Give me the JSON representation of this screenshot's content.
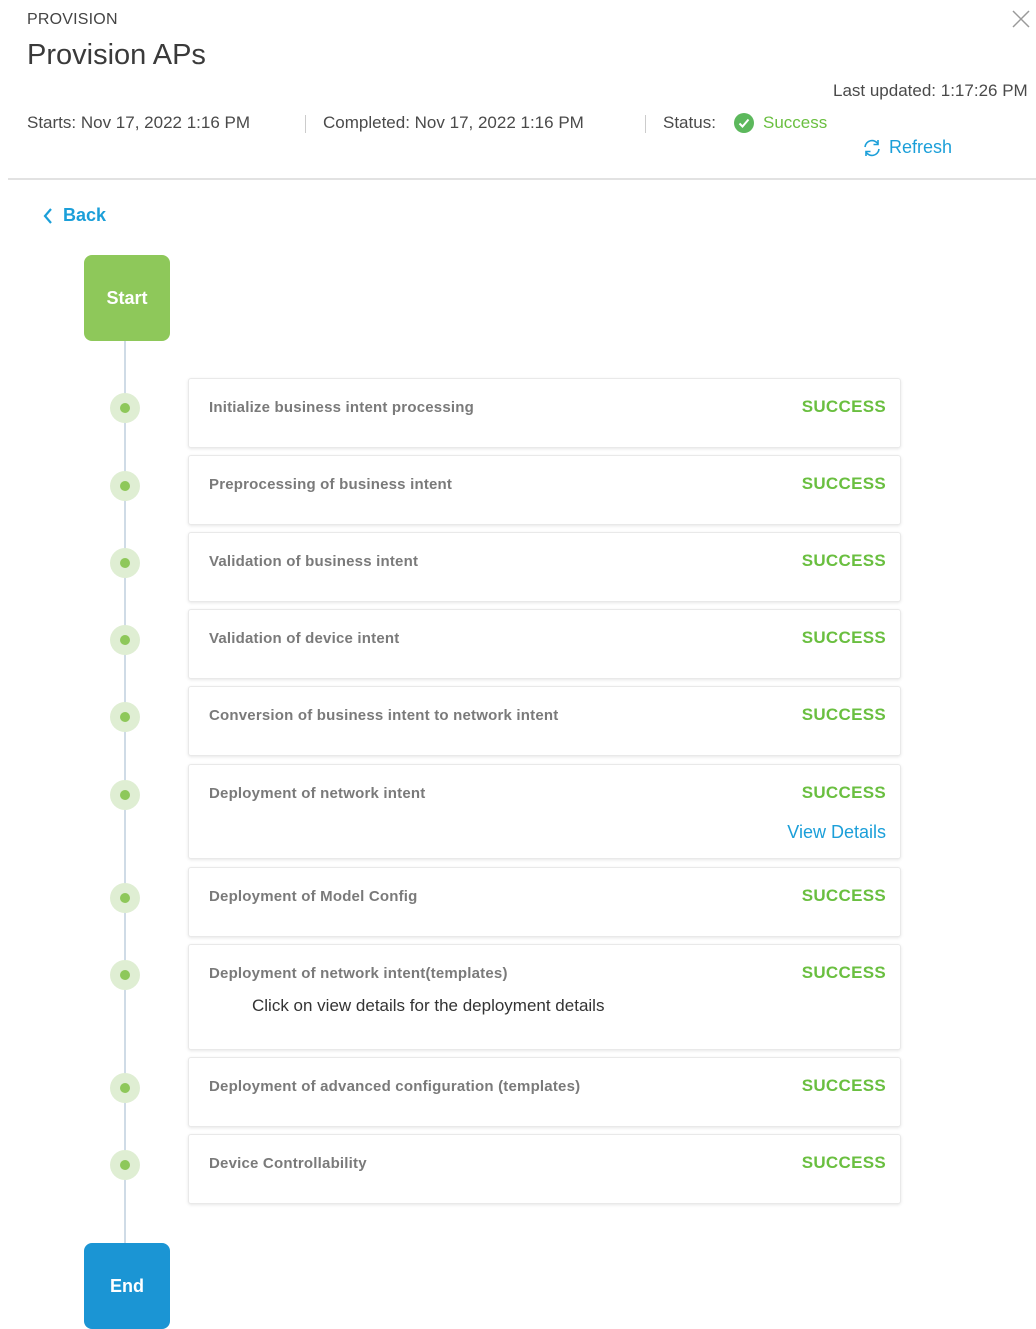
{
  "header": {
    "kicker": "PROVISION",
    "title": "Provision APs",
    "starts": "Starts: Nov 17, 2022 1:16 PM",
    "completed": "Completed: Nov 17, 2022 1:16 PM",
    "status_label": "Status:",
    "status_value": "Success",
    "last_updated": "Last updated: 1:17:26 PM",
    "refresh_label": "Refresh",
    "close_icon": "close-icon"
  },
  "nav": {
    "back_label": "Back"
  },
  "timeline": {
    "start_label": "Start",
    "end_label": "End",
    "steps": [
      {
        "label": "Initialize business intent processing",
        "status": "SUCCESS"
      },
      {
        "label": "Preprocessing of business intent",
        "status": "SUCCESS"
      },
      {
        "label": "Validation of business intent",
        "status": "SUCCESS"
      },
      {
        "label": "Validation of device intent",
        "status": "SUCCESS"
      },
      {
        "label": "Conversion of business intent to network intent",
        "status": "SUCCESS"
      },
      {
        "label": "Deployment of network intent",
        "status": "SUCCESS",
        "link": "View Details"
      },
      {
        "label": "Deployment of Model Config",
        "status": "SUCCESS"
      },
      {
        "label": "Deployment of network intent(templates)",
        "status": "SUCCESS",
        "note": "Click on view details for the deployment details"
      },
      {
        "label": "Deployment of advanced configuration (templates)",
        "status": "SUCCESS"
      },
      {
        "label": "Device Controllability",
        "status": "SUCCESS"
      }
    ]
  },
  "colors": {
    "success": "#6abf40",
    "link": "#1b9fd9",
    "start_node": "#8ec85a",
    "end_node": "#1b95d4"
  }
}
